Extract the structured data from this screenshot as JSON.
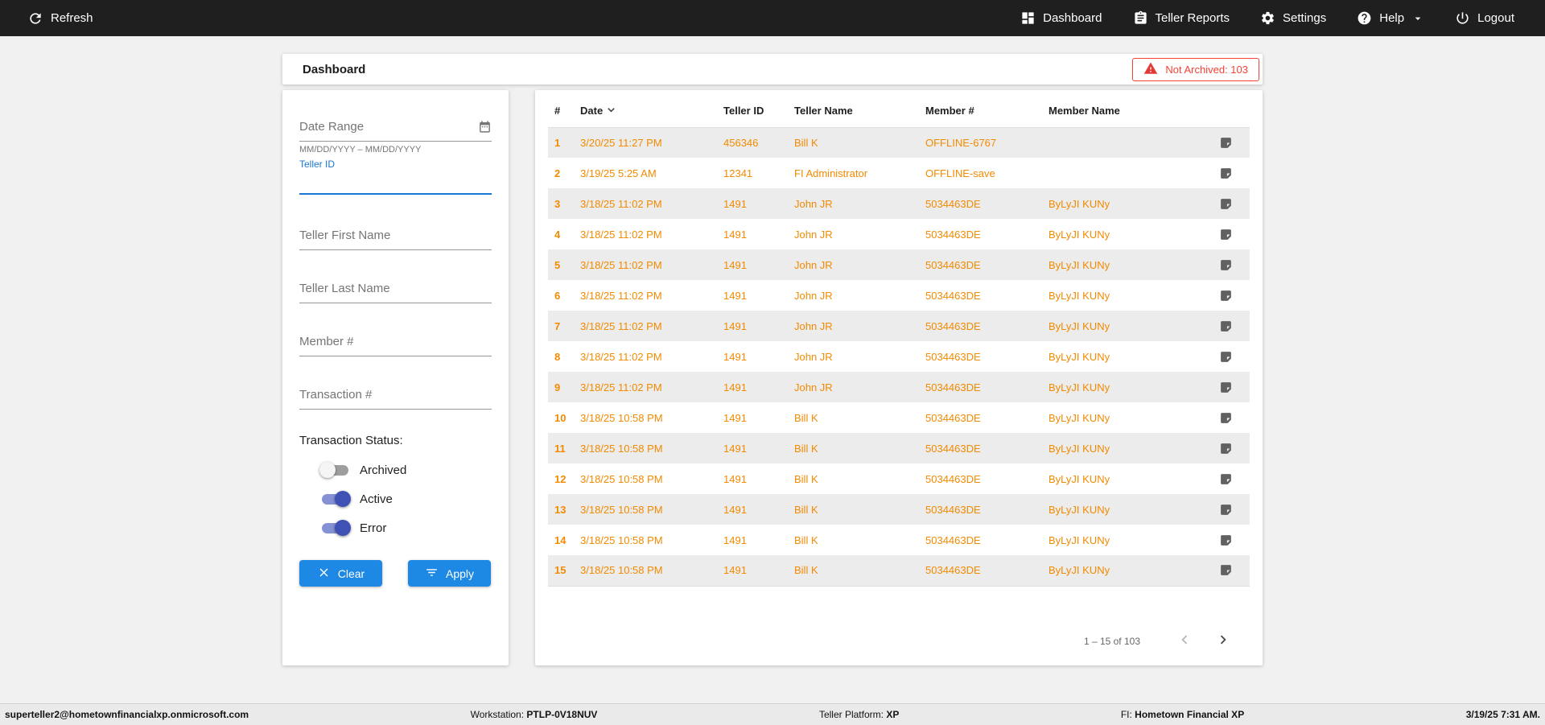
{
  "topbar": {
    "refresh": {
      "label": "Refresh",
      "icon": "refresh-icon"
    },
    "items": [
      {
        "label": "Dashboard",
        "icon": "dashboard-icon"
      },
      {
        "label": "Teller Reports",
        "icon": "teller-reports-icon"
      },
      {
        "label": "Settings",
        "icon": "settings-icon"
      },
      {
        "label": "Help",
        "icon": "help-icon",
        "caret": "chevron-down-icon"
      },
      {
        "label": "Logout",
        "icon": "logout-icon"
      }
    ]
  },
  "page_header": {
    "title": "Dashboard",
    "not_archived_badge": {
      "label": "Not Archived: 103",
      "icon": "warning-icon",
      "color": "#f44336"
    }
  },
  "filters": {
    "date_range": {
      "placeholder": "Date Range",
      "value": "",
      "helper": "MM/DD/YYYY – MM/DD/YYYY",
      "icon": "calendar-icon"
    },
    "teller_id": {
      "label": "Teller ID",
      "value": ""
    },
    "teller_first_name": {
      "placeholder": "Teller First Name",
      "value": ""
    },
    "teller_last_name": {
      "placeholder": "Teller Last Name",
      "value": ""
    },
    "member_number": {
      "placeholder": "Member #",
      "value": ""
    },
    "transaction_number": {
      "placeholder": "Transaction #",
      "value": ""
    },
    "status_label": "Transaction Status:",
    "toggles": [
      {
        "label": "Archived",
        "on": false
      },
      {
        "label": "Active",
        "on": true
      },
      {
        "label": "Error",
        "on": true
      }
    ],
    "clear_button": "Clear",
    "apply_button": "Apply"
  },
  "table": {
    "columns": [
      "#",
      "Date",
      "Teller ID",
      "Teller Name",
      "Member #",
      "Member Name"
    ],
    "rows": [
      {
        "num": "1",
        "date": "3/20/25 11:27 PM",
        "teller_id": "456346",
        "teller_name": "Bill K",
        "member_num": "OFFLINE-6767",
        "member_name": ""
      },
      {
        "num": "2",
        "date": "3/19/25 5:25 AM",
        "teller_id": "12341",
        "teller_name": "FI Administrator",
        "member_num": "OFFLINE-save",
        "member_name": ""
      },
      {
        "num": "3",
        "date": "3/18/25 11:02 PM",
        "teller_id": "1491",
        "teller_name": "John JR",
        "member_num": "5034463DE",
        "member_name": "ByLyJI KUNy"
      },
      {
        "num": "4",
        "date": "3/18/25 11:02 PM",
        "teller_id": "1491",
        "teller_name": "John JR",
        "member_num": "5034463DE",
        "member_name": "ByLyJI KUNy"
      },
      {
        "num": "5",
        "date": "3/18/25 11:02 PM",
        "teller_id": "1491",
        "teller_name": "John JR",
        "member_num": "5034463DE",
        "member_name": "ByLyJI KUNy"
      },
      {
        "num": "6",
        "date": "3/18/25 11:02 PM",
        "teller_id": "1491",
        "teller_name": "John JR",
        "member_num": "5034463DE",
        "member_name": "ByLyJI KUNy"
      },
      {
        "num": "7",
        "date": "3/18/25 11:02 PM",
        "teller_id": "1491",
        "teller_name": "John JR",
        "member_num": "5034463DE",
        "member_name": "ByLyJI KUNy"
      },
      {
        "num": "8",
        "date": "3/18/25 11:02 PM",
        "teller_id": "1491",
        "teller_name": "John JR",
        "member_num": "5034463DE",
        "member_name": "ByLyJI KUNy"
      },
      {
        "num": "9",
        "date": "3/18/25 11:02 PM",
        "teller_id": "1491",
        "teller_name": "John JR",
        "member_num": "5034463DE",
        "member_name": "ByLyJI KUNy"
      },
      {
        "num": "10",
        "date": "3/18/25 10:58 PM",
        "teller_id": "1491",
        "teller_name": "Bill K",
        "member_num": "5034463DE",
        "member_name": "ByLyJI KUNy"
      },
      {
        "num": "11",
        "date": "3/18/25 10:58 PM",
        "teller_id": "1491",
        "teller_name": "Bill K",
        "member_num": "5034463DE",
        "member_name": "ByLyJI KUNy"
      },
      {
        "num": "12",
        "date": "3/18/25 10:58 PM",
        "teller_id": "1491",
        "teller_name": "Bill K",
        "member_num": "5034463DE",
        "member_name": "ByLyJI KUNy"
      },
      {
        "num": "13",
        "date": "3/18/25 10:58 PM",
        "teller_id": "1491",
        "teller_name": "Bill K",
        "member_num": "5034463DE",
        "member_name": "ByLyJI KUNy"
      },
      {
        "num": "14",
        "date": "3/18/25 10:58 PM",
        "teller_id": "1491",
        "teller_name": "Bill K",
        "member_num": "5034463DE",
        "member_name": "ByLyJI KUNy"
      },
      {
        "num": "15",
        "date": "3/18/25 10:58 PM",
        "teller_id": "1491",
        "teller_name": "Bill K",
        "member_num": "5034463DE",
        "member_name": "ByLyJI KUNy"
      }
    ],
    "pagination": {
      "range_label": "1 – 15 of 103"
    }
  },
  "footer": {
    "user": "superteller2@hometownfinancialxp.onmicrosoft.com",
    "workstation_label": "Workstation:",
    "workstation_value": "PTLP-0V18NUV",
    "platform_label": "Teller Platform:",
    "platform_value": "XP",
    "fi_label": "FI:",
    "fi_value": "Hometown Financial XP",
    "datetime": "3/19/25 7:31 AM."
  },
  "colors": {
    "topbar_bg": "#1f1f1f",
    "accent_blue": "#1e88e5",
    "focus_blue": "#1976d2",
    "row_orange": "#f38a00",
    "alert_red": "#f44336",
    "toggle_on": "#3f51b5"
  }
}
